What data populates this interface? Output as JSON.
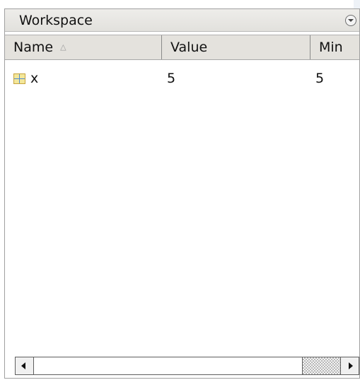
{
  "panel": {
    "title": "Workspace"
  },
  "columns": {
    "name": "Name",
    "value": "Value",
    "min": "Min"
  },
  "rows": [
    {
      "name": "x",
      "value": "5",
      "min": "5",
      "icon": "matrix-variable-icon"
    }
  ],
  "icons": {
    "panel_menu": "chevron-down-circle-icon",
    "sort": "sort-ascending-icon",
    "scroll_left": "arrow-left-icon",
    "scroll_right": "arrow-right-icon"
  },
  "colors": {
    "header_bg": "#e4e2dd",
    "variable_icon_fill": "#f3e79a",
    "variable_icon_grid": "#4d8bd6"
  }
}
